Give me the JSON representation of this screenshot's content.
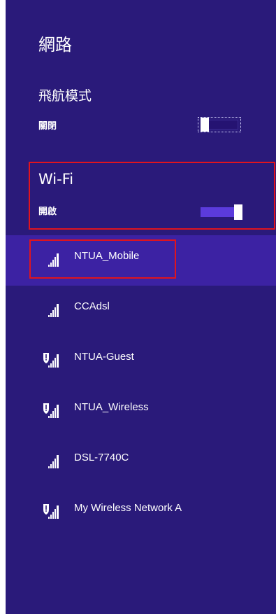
{
  "panel": {
    "title": "網路",
    "airplane_mode": {
      "label": "飛航模式",
      "state": "關閉",
      "on": false
    },
    "wifi": {
      "label": "Wi-Fi",
      "state": "開啟",
      "on": true
    }
  },
  "networks": [
    {
      "name": "NTUA_Mobile",
      "secured": false,
      "selected": true,
      "icon": "wifi-signal-icon"
    },
    {
      "name": "CCAdsl",
      "secured": false,
      "selected": false,
      "icon": "wifi-signal-icon"
    },
    {
      "name": "NTUA-Guest",
      "secured": true,
      "selected": false,
      "icon": "wifi-shield-signal-icon"
    },
    {
      "name": "NTUA_Wireless",
      "secured": true,
      "selected": false,
      "icon": "wifi-shield-signal-icon"
    },
    {
      "name": "DSL-7740C",
      "secured": false,
      "selected": false,
      "icon": "wifi-signal-icon"
    },
    {
      "name": "My Wireless Network A",
      "secured": true,
      "selected": false,
      "icon": "wifi-shield-signal-icon"
    }
  ],
  "colors": {
    "panel_bg": "#2a1a7a",
    "selected_bg": "#3c22a3",
    "toggle_on_track": "#5b3bdc",
    "highlight_border": "#e0141e",
    "text": "#ffffff"
  }
}
